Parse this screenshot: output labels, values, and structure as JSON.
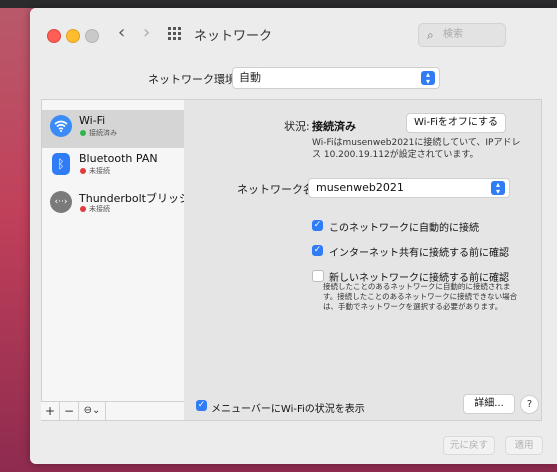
{
  "window": {
    "title": "ネットワーク"
  },
  "toolbar": {
    "back": "‹",
    "forward": "›",
    "search_placeholder": "検索"
  },
  "location": {
    "label": "ネットワーク環境:",
    "value": "自動"
  },
  "services": [
    {
      "name": "Wi-Fi",
      "status": "接続済み",
      "status_color": "#30b64a",
      "icon": "wifi-icon",
      "selected": true
    },
    {
      "name": "Bluetooth PAN",
      "status": "未接続",
      "status_color": "#e23b3b",
      "icon": "bluetooth-icon"
    },
    {
      "name": "Thunderboltブリッジ",
      "status": "未接続",
      "status_color": "#e23b3b",
      "icon": "thunderbolt-bridge-icon"
    }
  ],
  "sidebar_controls": {
    "add": "+",
    "remove": "−",
    "action": "⊖⌄"
  },
  "detail": {
    "status_label": "状況:",
    "status_value": "接続済み",
    "wifi_off_button": "Wi-Fiをオフにする",
    "description": "Wi-Fiはmusenweb2021に接続していて、IPアドレス 10.200.19.112が設定されています。",
    "network_name_label": "ネットワーク名:",
    "network_name": "musenweb2021",
    "options": [
      {
        "label": "このネットワークに自動的に接続",
        "checked": true
      },
      {
        "label": "インターネット共有に接続する前に確認",
        "checked": true
      },
      {
        "label": "新しいネットワークに接続する前に確認",
        "checked": false
      }
    ],
    "note": "接続したことのあるネットワークに自動的に接続されます。接続したことのあるネットワークに接続できない場合は、手動でネットワークを選択する必要があります。"
  },
  "bottom": {
    "show_in_menubar": "メニューバーにWi-Fiの状況を表示",
    "show_in_menubar_checked": true,
    "advanced": "詳細...",
    "help": "?",
    "revert": "元に戻す",
    "apply": "適用"
  },
  "colors": {
    "accent": "#2f7cf6",
    "connected": "#30b64a",
    "disconnected": "#e23b3b"
  }
}
